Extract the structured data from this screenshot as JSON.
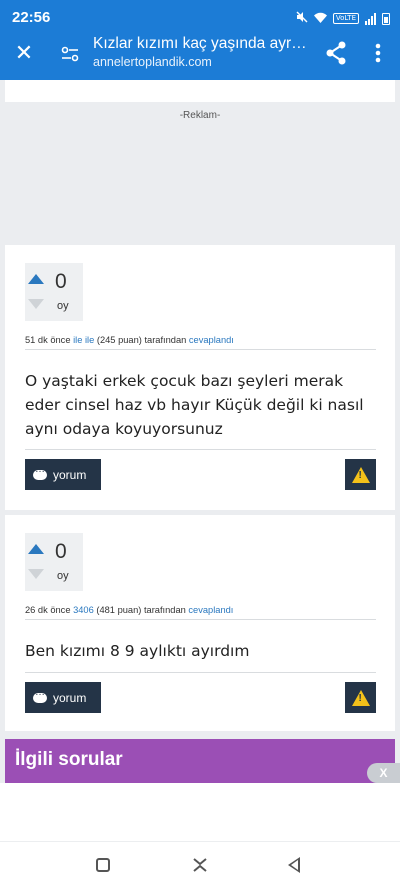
{
  "status_bar": {
    "time": "22:56",
    "network_badge": "VoLTE"
  },
  "app_bar": {
    "title": "Kızlar kızımı kaç yaşında ayrı odaya aldınız",
    "url": "annelertoplandik.com"
  },
  "ad": {
    "label": "-Reklam-"
  },
  "answers": [
    {
      "votes": "0",
      "votes_label": "oy",
      "time_ago": "51 dk önce",
      "user": "ile ile",
      "points": "(245 puan)",
      "by_text": "tarafından",
      "action": "cevaplandı",
      "text": "O yaştaki erkek çocuk bazı şeyleri merak eder cinsel haz vb hayır Küçük değil ki nasıl aynı odaya koyuyorsunuz",
      "comment_label": "yorum"
    },
    {
      "votes": "0",
      "votes_label": "oy",
      "time_ago": "26 dk önce",
      "user": "3406",
      "points": "(481 puan)",
      "by_text": "tarafından",
      "action": "cevaplandı",
      "text": "Ben kızımı 8 9 aylıktı ayırdım",
      "comment_label": "yorum"
    }
  ],
  "related": {
    "title": "İlgili sorular",
    "close_label": "X"
  },
  "colors": {
    "app_bar": "#1c7cd6",
    "accent_link": "#2a78bf",
    "button_dark": "#243447",
    "related_bg": "#9b4fb5",
    "warning": "#f3c11a"
  }
}
